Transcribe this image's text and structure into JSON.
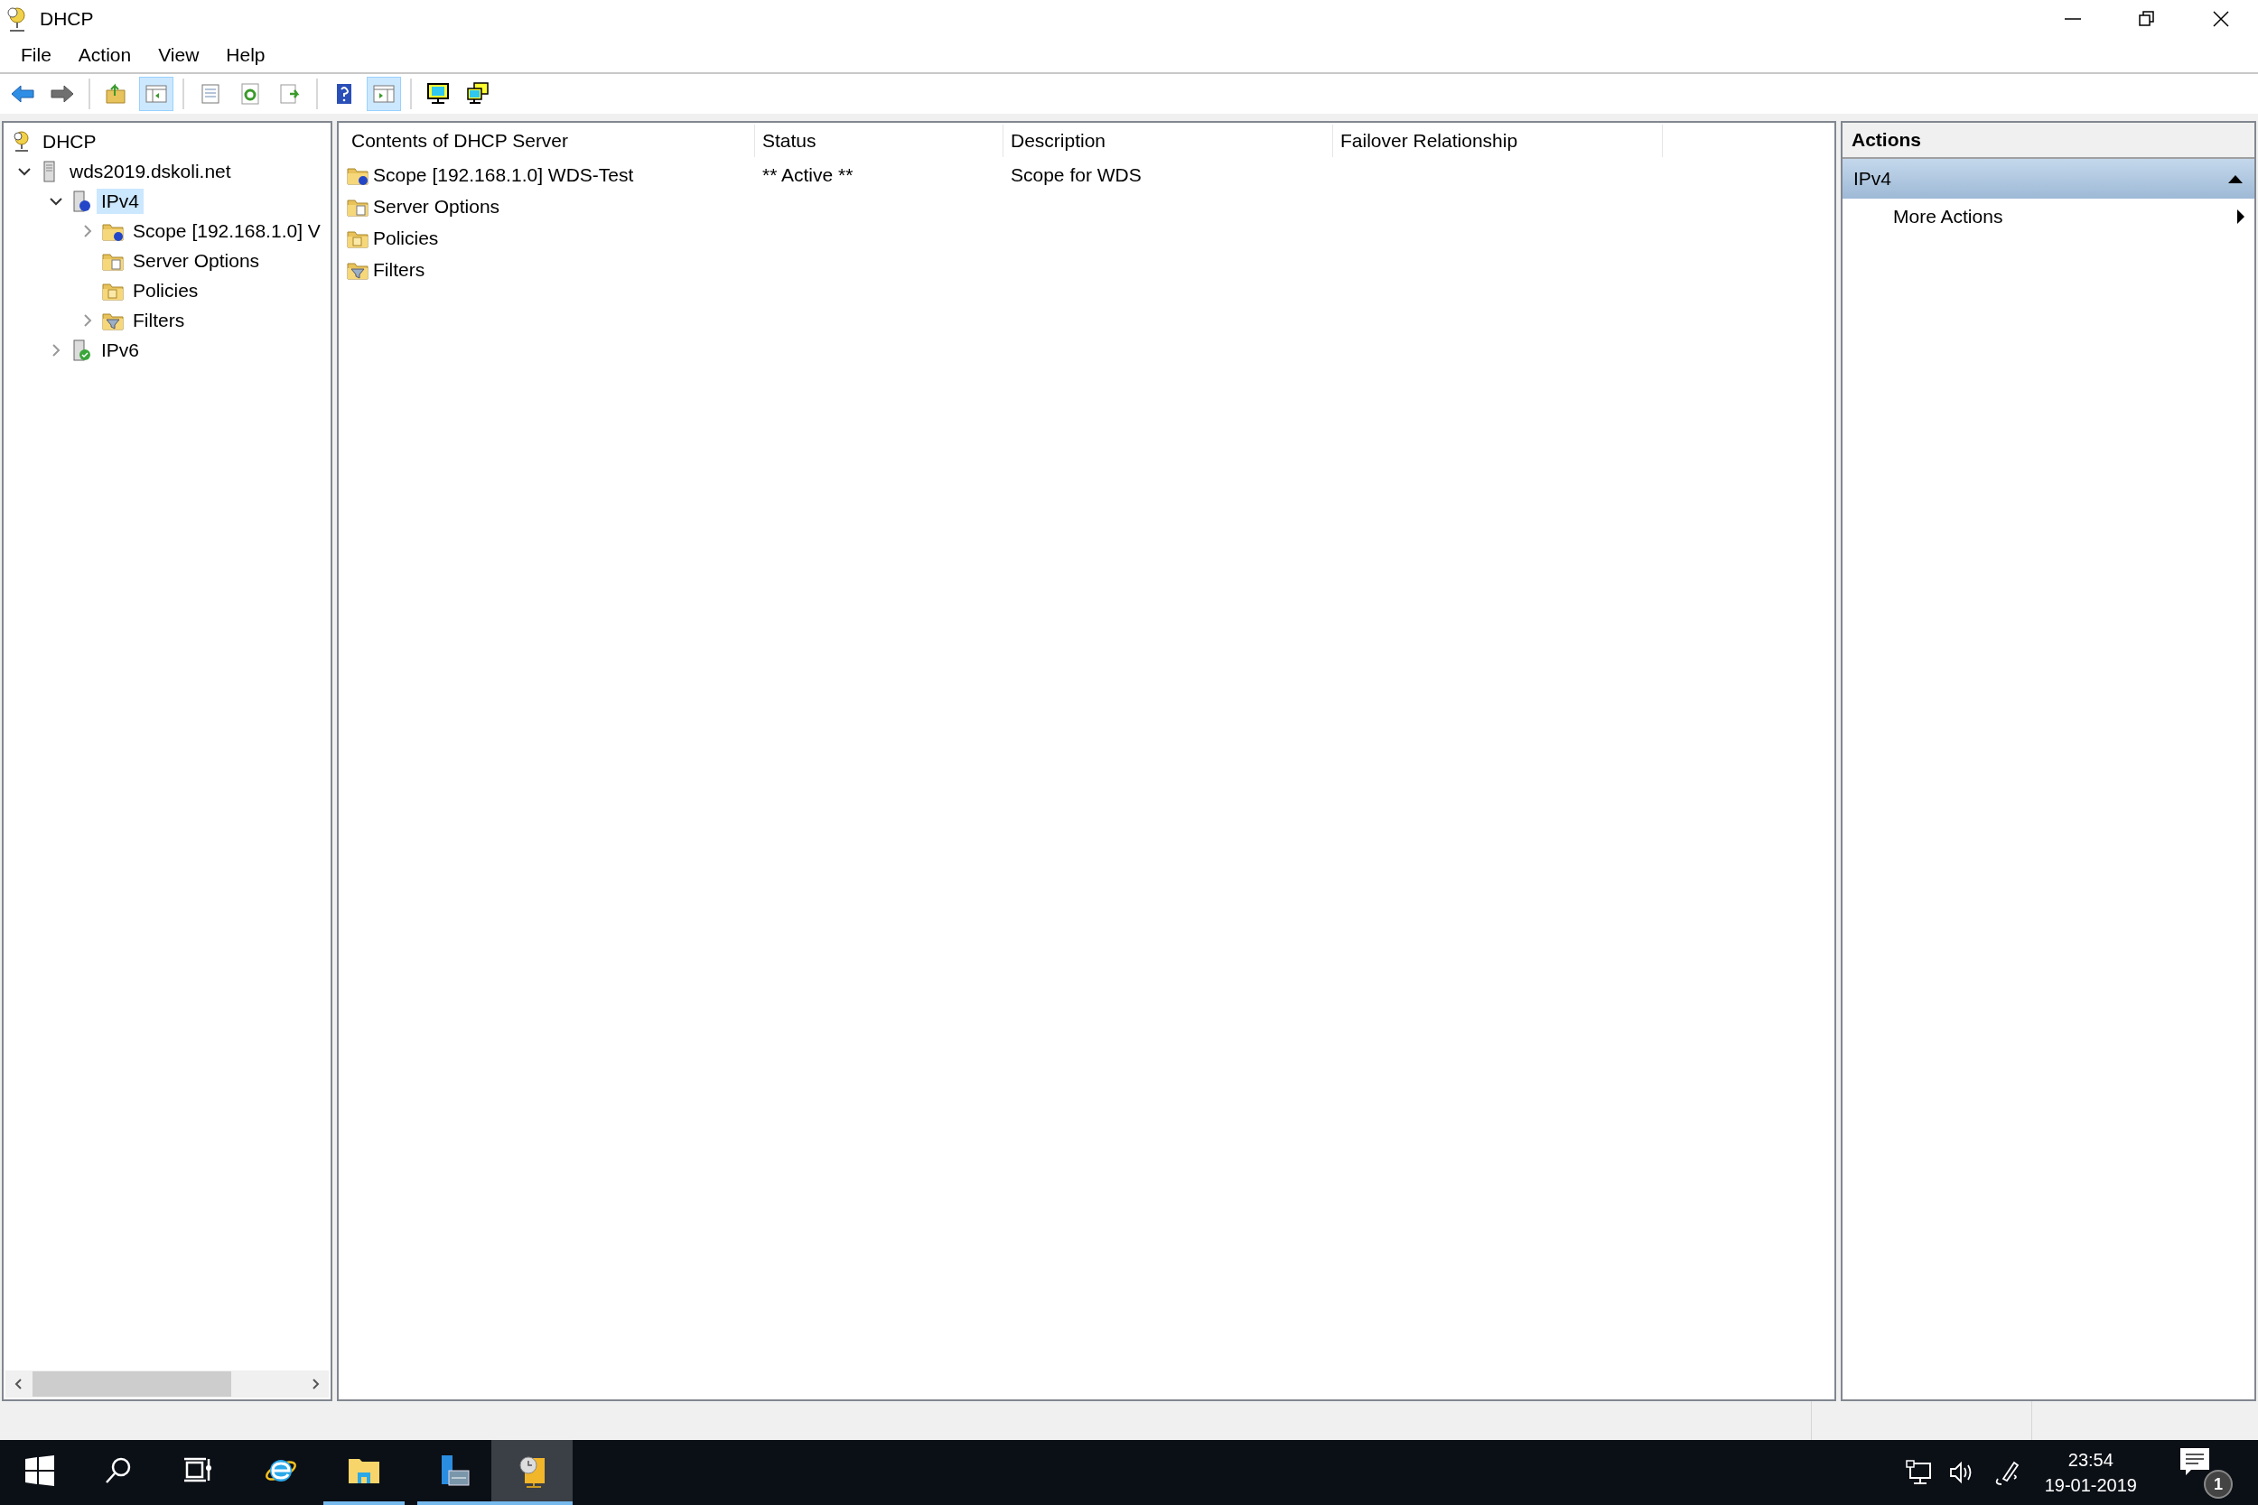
{
  "window": {
    "title": "DHCP"
  },
  "menu": [
    "File",
    "Action",
    "View",
    "Help"
  ],
  "toolbar": [
    {
      "kind": "back",
      "pressed": false
    },
    {
      "kind": "forward",
      "pressed": false
    },
    {
      "kind": "separator"
    },
    {
      "kind": "up",
      "pressed": false
    },
    {
      "kind": "console-tree",
      "pressed": true
    },
    {
      "kind": "separator"
    },
    {
      "kind": "properties",
      "pressed": false
    },
    {
      "kind": "refresh",
      "pressed": false
    },
    {
      "kind": "export",
      "pressed": false
    },
    {
      "kind": "separator"
    },
    {
      "kind": "help",
      "pressed": false
    },
    {
      "kind": "action-pane",
      "pressed": true
    },
    {
      "kind": "separator"
    },
    {
      "kind": "monitor",
      "pressed": false
    },
    {
      "kind": "monitors",
      "pressed": false
    }
  ],
  "tree": [
    {
      "label": "DHCP",
      "kind": "dhcp",
      "selected": false,
      "children": [
        {
          "label": "wds2019.dskoli.net",
          "kind": "server",
          "selected": false,
          "expanded": true,
          "children": [
            {
              "label": "IPv4",
              "kind": "ipv4",
              "selected": true,
              "expanded": true,
              "children": [
                {
                  "label": "Scope [192.168.1.0] V",
                  "kind": "scope",
                  "selected": false,
                  "expanded": false
                },
                {
                  "label": "Server Options",
                  "kind": "options",
                  "selected": false
                },
                {
                  "label": "Policies",
                  "kind": "policies",
                  "selected": false
                },
                {
                  "label": "Filters",
                  "kind": "filters",
                  "selected": false,
                  "expanded": false
                }
              ]
            },
            {
              "label": "IPv6",
              "kind": "ipv6",
              "selected": false,
              "expanded": false
            }
          ]
        }
      ]
    }
  ],
  "list": {
    "columns": [
      "Contents of DHCP Server",
      "Status",
      "Description",
      "Failover Relationship"
    ],
    "rows": [
      {
        "kind": "scope",
        "cells": [
          "Scope [192.168.1.0] WDS-Test",
          "** Active **",
          "Scope for WDS"
        ]
      },
      {
        "kind": "options",
        "cells": [
          "Server Options"
        ]
      },
      {
        "kind": "policies",
        "cells": [
          "Policies"
        ]
      },
      {
        "kind": "filters",
        "cells": [
          "Filters"
        ]
      }
    ]
  },
  "actions": {
    "title": "Actions",
    "sections": [
      {
        "title": "IPv4",
        "expanded": true,
        "items": [
          "More Actions"
        ]
      }
    ]
  },
  "taskbar": {
    "apps": [
      {
        "kind": "start",
        "running": false,
        "active": false
      },
      {
        "kind": "search",
        "running": false,
        "active": false
      },
      {
        "kind": "task-view",
        "running": false,
        "active": false
      },
      {
        "kind": "browser",
        "running": false,
        "active": false
      },
      {
        "kind": "folder",
        "running": true,
        "active": false
      },
      {
        "kind": "server-manager",
        "running": true,
        "active": false
      },
      {
        "kind": "dhcp",
        "running": true,
        "active": true
      }
    ],
    "time": "23:54",
    "date": "19-01-2019",
    "notifications": "1"
  }
}
